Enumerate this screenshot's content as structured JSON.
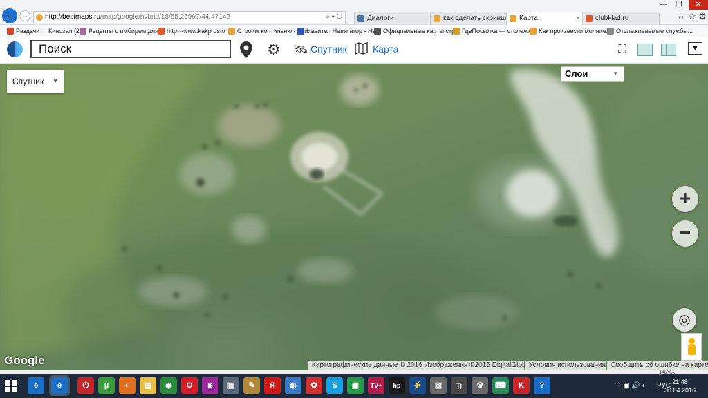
{
  "browser": {
    "address": {
      "host": "http://bestmaps.ru",
      "path": "/map/google/hybrid/18/55.26997/44.47142"
    },
    "tabs": [
      {
        "label": "Диалоги",
        "color": "#4a76a8"
      },
      {
        "label": "как сделать скриншот э...",
        "color": "#e8a33a"
      },
      {
        "label": "Карта",
        "color": "#e8a33a"
      },
      {
        "label": "clubklad.ru",
        "color": "#e05a2a"
      }
    ],
    "bookmarks": [
      {
        "label": "Раздачи",
        "color": "#d64a2e"
      },
      {
        "label": "Кинозал (2)",
        "color": "#888888"
      },
      {
        "label": "Рецепты с имбирем для ...",
        "color": "#a06aa0"
      },
      {
        "label": "http---www.kakprosto",
        "color": "#e05a2a"
      },
      {
        "label": "Строим коптильню - еди...",
        "color": "#e8a33a"
      },
      {
        "label": "Навител Навигатор - Не...",
        "color": "#2a56b8"
      },
      {
        "label": "Официальные карты стр...",
        "color": "#555555"
      },
      {
        "label": "ГдеПосылка — отслежи...",
        "color": "#d0a020"
      },
      {
        "label": "Как произвести молниез...",
        "color": "#e8a33a"
      },
      {
        "label": "Отслеживаемые службы...",
        "color": "#888888"
      }
    ]
  },
  "header": {
    "search_placeholder": "Поиск",
    "satellite_label": "Спутник",
    "map_label": "Карта",
    "menu_glyph": "▼"
  },
  "map": {
    "type_select": "Спутник",
    "layers_select": "Слои",
    "zoom_in": "+",
    "zoom_out": "−",
    "logo": "Google",
    "attribution": {
      "data": "Картографические данные © 2016 Изображения ©2016 DigitalGlobe",
      "terms": "Условия использования",
      "report": "Сообщить об ошибке на карте"
    }
  },
  "statusbar": {
    "zoom": "150%"
  },
  "taskbar": {
    "apps": [
      {
        "name": "ie",
        "glyph": "e",
        "color": "#1a6fc4"
      },
      {
        "name": "power",
        "glyph": "⏻",
        "color": "#c0282c"
      },
      {
        "name": "utorrent",
        "glyph": "µ",
        "color": "#3d9a3d"
      },
      {
        "name": "firefox",
        "glyph": "◐",
        "color": "#e07020"
      },
      {
        "name": "folder",
        "glyph": "▤",
        "color": "#e8c04a"
      },
      {
        "name": "chrome",
        "glyph": "◉",
        "color": "#2b8a3e"
      },
      {
        "name": "opera",
        "glyph": "O",
        "color": "#d21d2a"
      },
      {
        "name": "camera",
        "glyph": "◙",
        "color": "#9a2a9a"
      },
      {
        "name": "printer",
        "glyph": "▥",
        "color": "#5a6a7a"
      },
      {
        "name": "tool",
        "glyph": "✎",
        "color": "#b08a3a"
      },
      {
        "name": "yandex",
        "glyph": "Я",
        "color": "#d01a1a"
      },
      {
        "name": "app-globe",
        "glyph": "◍",
        "color": "#3a7ac4"
      },
      {
        "name": "app-red",
        "glyph": "✿",
        "color": "#d03030"
      },
      {
        "name": "skype",
        "glyph": "S",
        "color": "#19a0e0"
      },
      {
        "name": "chat",
        "glyph": "▣",
        "color": "#2a9a4a"
      },
      {
        "name": "tvplus",
        "glyph": "TV+",
        "color": "#b0204a"
      },
      {
        "name": "hp",
        "glyph": "hp",
        "color": "#1a1a1a"
      },
      {
        "name": "flash",
        "glyph": "⚡",
        "color": "#1a4a8a"
      },
      {
        "name": "lock",
        "glyph": "▨",
        "color": "#6a6a6a"
      },
      {
        "name": "text",
        "glyph": "Tj",
        "color": "#4a4a4a"
      },
      {
        "name": "gear",
        "glyph": "⚙",
        "color": "#6a6a6a"
      },
      {
        "name": "keyboard",
        "glyph": "⌨",
        "color": "#2a8a5a"
      },
      {
        "name": "game",
        "glyph": "K",
        "color": "#c0282c"
      },
      {
        "name": "help",
        "glyph": "?",
        "color": "#1a6fc4"
      }
    ],
    "lang": "РУС",
    "time": "21:48",
    "date": "30.04.2016"
  },
  "colors": {
    "accent": "#1d72c6",
    "taskbar": "#1e2a3a"
  }
}
